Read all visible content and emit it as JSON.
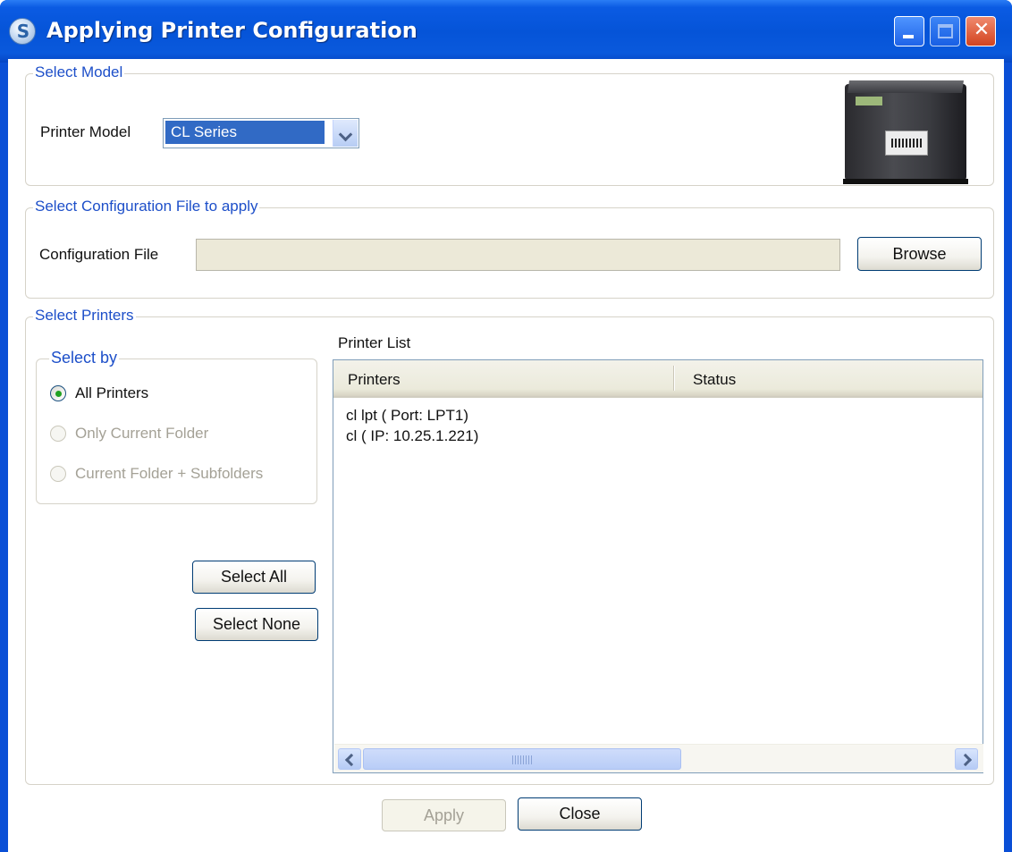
{
  "window": {
    "title": "Applying Printer Configuration",
    "close_glyph": "✕"
  },
  "select_model": {
    "legend": "Select Model",
    "printer_model_label": "Printer Model",
    "printer_model_value": "CL Series"
  },
  "config_file": {
    "legend": "Select Configuration File to apply",
    "label": "Configuration File",
    "value": "",
    "browse_label": "Browse"
  },
  "select_printers": {
    "legend": "Select Printers",
    "select_by": {
      "legend": "Select by",
      "options": [
        {
          "label": "All Printers",
          "checked": true,
          "enabled": true
        },
        {
          "label": "Only Current Folder",
          "checked": false,
          "enabled": false
        },
        {
          "label": "Current Folder + Subfolders",
          "checked": false,
          "enabled": false
        }
      ]
    },
    "select_all_label": "Select All",
    "select_none_label": "Select None",
    "printer_list_label": "Printer List",
    "columns": [
      "Printers",
      "Status"
    ],
    "rows": [
      {
        "printer": "cl lpt ( Port: LPT1)",
        "status": ""
      },
      {
        "printer": "cl ( IP: 10.25.1.221)",
        "status": ""
      }
    ]
  },
  "footer": {
    "apply_label": "Apply",
    "close_label": "Close"
  },
  "icons": {
    "app": "app-logo-icon",
    "minimize": "minimize-icon",
    "maximize": "maximize-icon",
    "close": "close-icon",
    "dropdown": "chevron-down-icon",
    "scroll_left": "chevron-left-icon",
    "scroll_right": "chevron-right-icon"
  },
  "colors": {
    "titlebar": "#0554d8",
    "legend_text": "#1d4fc9",
    "selection": "#316ac5",
    "radio_checked": "#21a121"
  }
}
